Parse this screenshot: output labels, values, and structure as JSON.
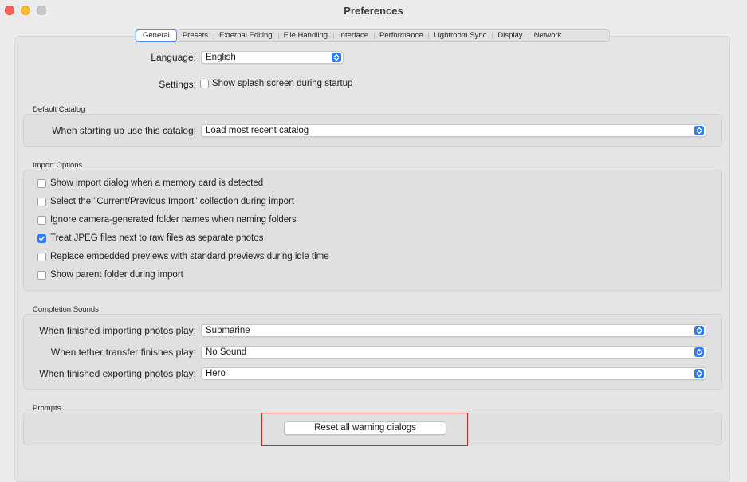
{
  "window": {
    "title": "Preferences"
  },
  "tabs": [
    "General",
    "Presets",
    "External Editing",
    "File Handling",
    "Interface",
    "Performance",
    "Lightroom Sync",
    "Display",
    "Network"
  ],
  "general": {
    "language_label": "Language:",
    "language_value": "English",
    "settings_label": "Settings:",
    "splash_label": "Show splash screen during startup",
    "splash_checked": false
  },
  "default_catalog": {
    "title": "Default Catalog",
    "label": "When starting up use this catalog:",
    "value": "Load most recent catalog"
  },
  "import_options": {
    "title": "Import Options",
    "items": [
      {
        "label": "Show import dialog when a memory card is detected",
        "checked": false
      },
      {
        "label": "Select the \"Current/Previous Import\" collection during import",
        "checked": false
      },
      {
        "label": "Ignore camera-generated folder names when naming folders",
        "checked": false
      },
      {
        "label": "Treat JPEG files next to raw files as separate photos",
        "checked": true
      },
      {
        "label": "Replace embedded previews with standard previews during idle time",
        "checked": false
      },
      {
        "label": "Show parent folder during import",
        "checked": false
      }
    ]
  },
  "completion_sounds": {
    "title": "Completion Sounds",
    "rows": [
      {
        "label": "When finished importing photos play:",
        "value": "Submarine"
      },
      {
        "label": "When tether transfer finishes play:",
        "value": "No Sound"
      },
      {
        "label": "When finished exporting photos play:",
        "value": "Hero"
      }
    ]
  },
  "prompts": {
    "title": "Prompts",
    "reset_button": "Reset all warning dialogs"
  },
  "colors": {
    "accent": "#2f7bf5",
    "highlight": "#d6202a",
    "close": "#fe5f57",
    "minimize": "#febc2e"
  }
}
